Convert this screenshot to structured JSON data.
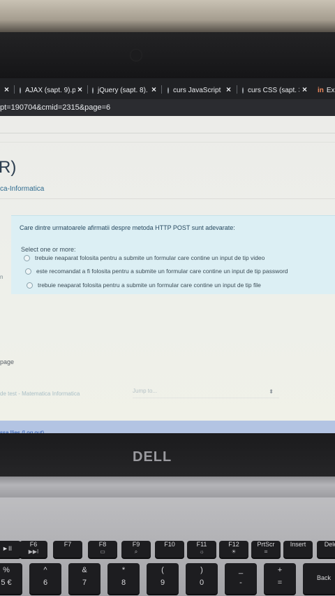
{
  "browser": {
    "tabs": [
      {
        "label": "",
        "close": "×"
      },
      {
        "label": "AJAX (sapt. 9).pdf",
        "close": "×"
      },
      {
        "label": "jQuery (sapt. 8).p",
        "close": "×"
      },
      {
        "label": "curs JavaScript (sa",
        "close": "×"
      },
      {
        "label": "curs CSS (sapt. 3-",
        "close": "×"
      },
      {
        "label": "Ex",
        "close": ""
      }
    ],
    "tab_brand": "in",
    "url": "pt=190704&cmid=2315&page=6"
  },
  "page": {
    "paren": "R)",
    "course_name": "ca-Informatica",
    "question": {
      "text": "Care dintre urmatoarele afirmatii despre metoda HTTP POST sunt adevarate:",
      "select_label": "Select one or more:",
      "options": [
        "trebuie neaparat folosita pentru a submite un formular care contine un input de tip video",
        "este recomandat a fi folosita pentru a submite un formular care contine un input de tip password",
        "trebuie neaparat folosita pentru a submite un formular care contine un input de tip file"
      ]
    },
    "left_marker": "n",
    "page_label": "page",
    "nav_link": "de test - Matematica Informatica",
    "jump_placeholder": "Jump to...",
    "jump_arrows": "⬍",
    "footer_user": "ssa Ilies",
    "footer_logout": "(Log out)"
  },
  "laptop": {
    "brand": "DELL"
  },
  "keyboard": {
    "fn_row": [
      {
        "label": "F6",
        "sub": "▶▶I"
      },
      {
        "label": "F7",
        "sub": ""
      },
      {
        "label": "F8",
        "sub": "▭"
      },
      {
        "label": "F9",
        "sub": "⌕"
      },
      {
        "label": "F10",
        "sub": ""
      },
      {
        "label": "F11",
        "sub": "☼"
      },
      {
        "label": "F12",
        "sub": "☀"
      },
      {
        "label": "PrtScr",
        "sub": "⌗"
      },
      {
        "label": "Insert",
        "sub": ""
      },
      {
        "label": "Dele",
        "sub": ""
      }
    ],
    "num_row": [
      {
        "top": "%",
        "bottom": "5 €"
      },
      {
        "top": "^",
        "bottom": "6"
      },
      {
        "top": "&",
        "bottom": "7"
      },
      {
        "top": "*",
        "bottom": "8"
      },
      {
        "top": "(",
        "bottom": "9"
      },
      {
        "top": ")",
        "bottom": "0"
      },
      {
        "top": "_",
        "bottom": "-"
      },
      {
        "top": "+",
        "bottom": "="
      },
      {
        "top": "",
        "bottom": "Back"
      }
    ],
    "fn_left": "►II"
  }
}
